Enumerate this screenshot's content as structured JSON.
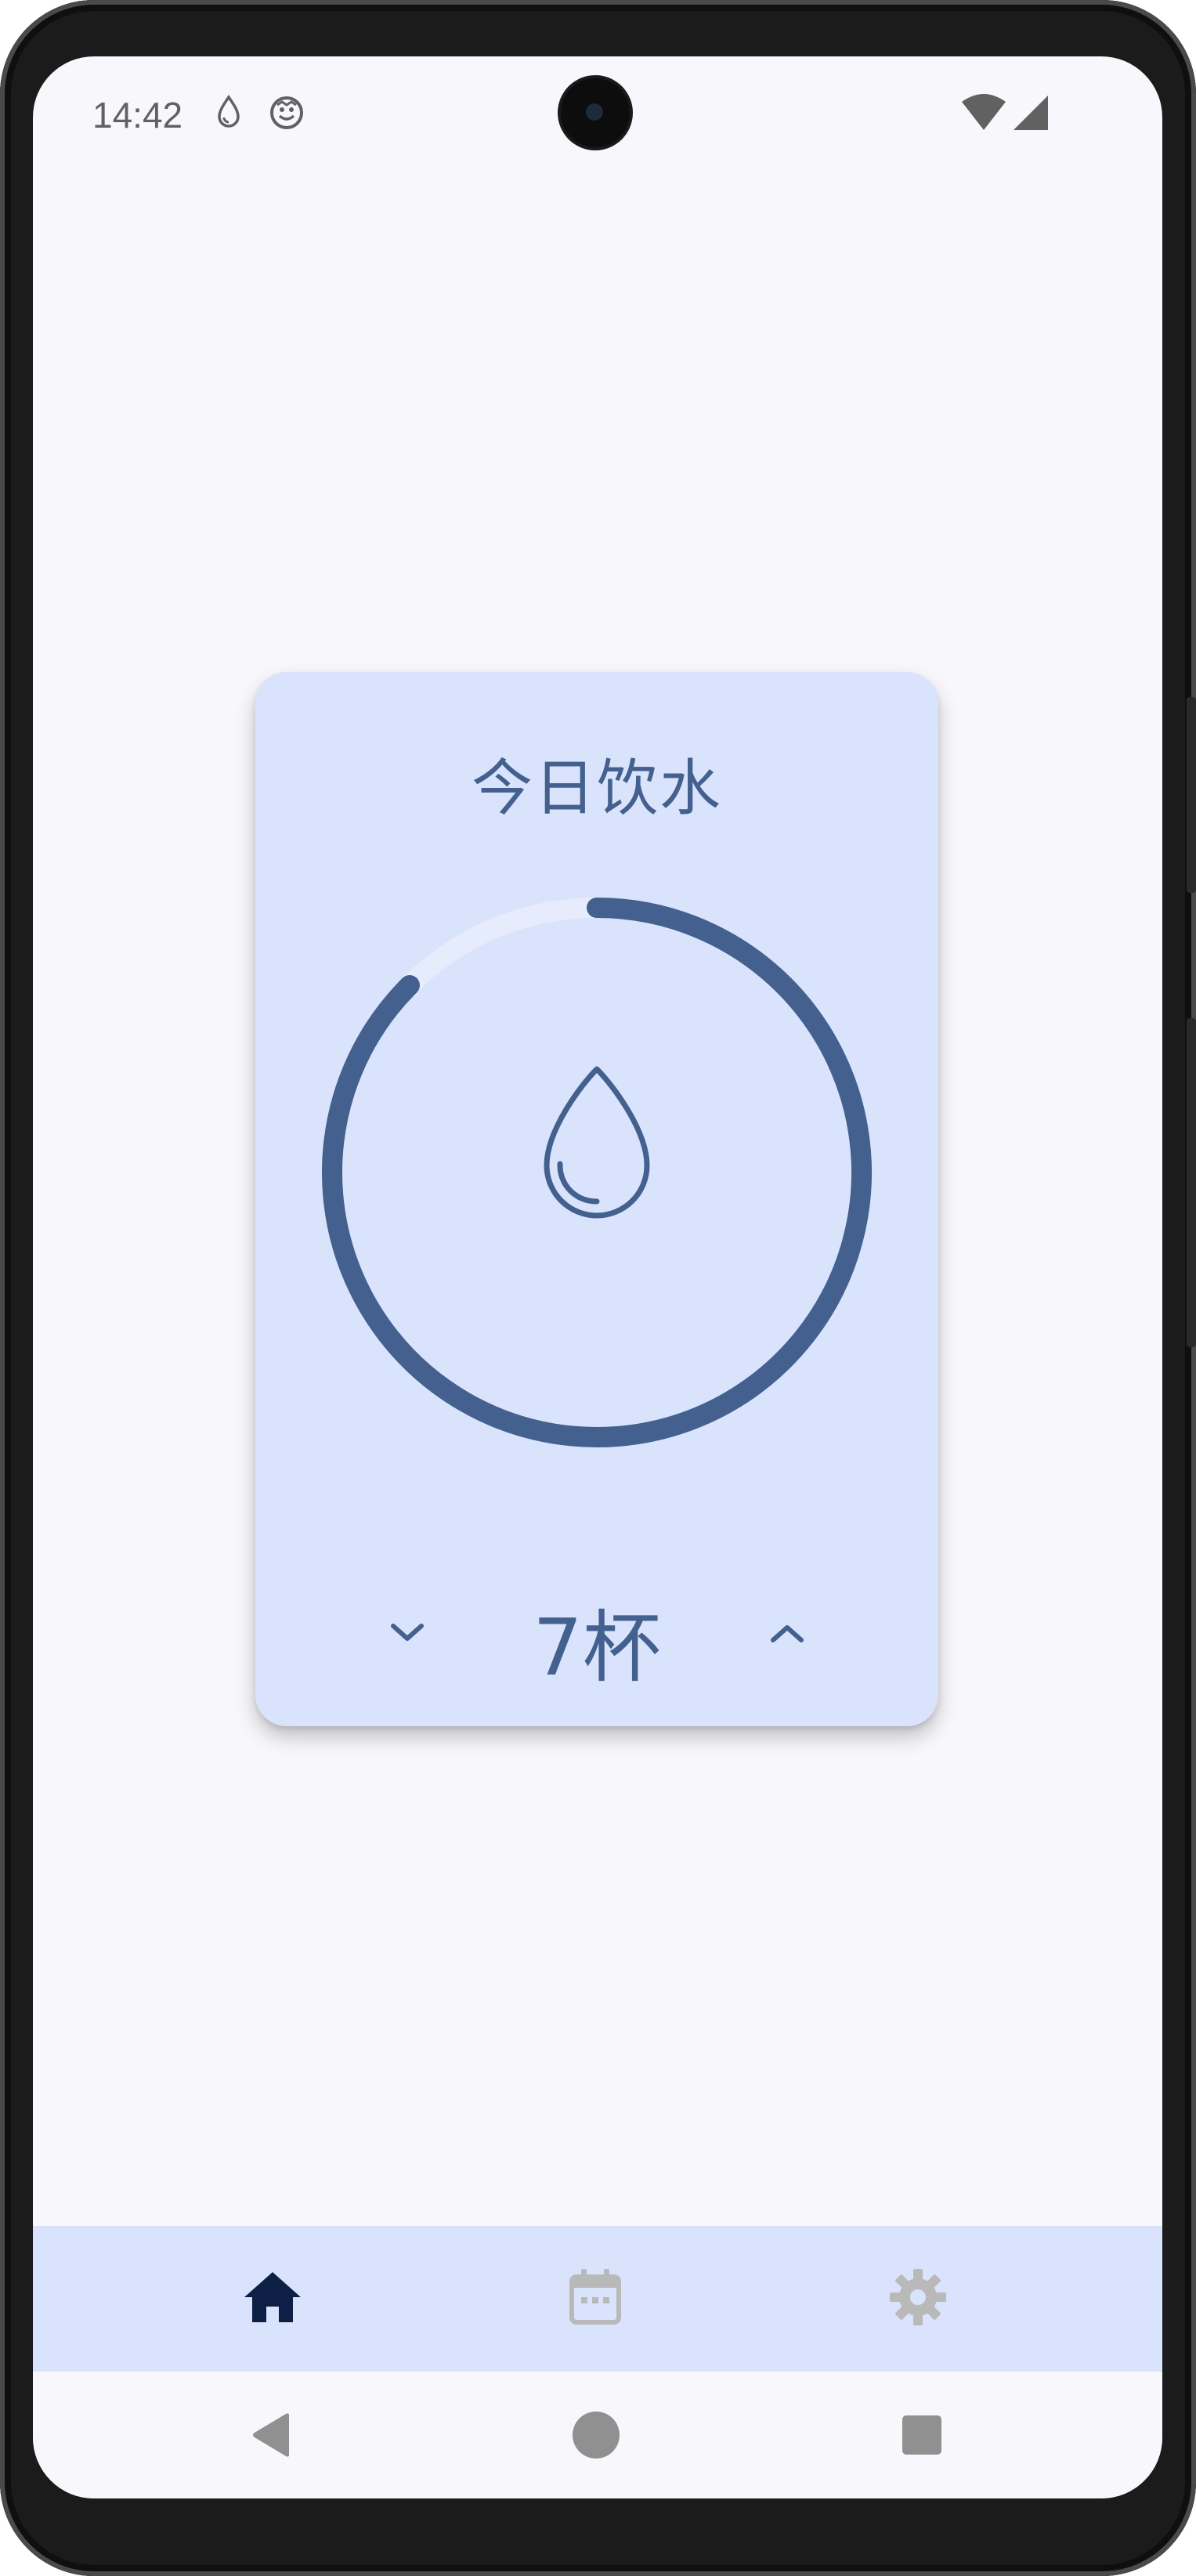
{
  "status_bar": {
    "time": "14:42",
    "notification_icons": [
      "water-drop-icon",
      "smiley-icon"
    ],
    "system_icons": [
      "wifi-icon",
      "cellular-signal-icon"
    ]
  },
  "card": {
    "title": "今日饮水",
    "progress_fraction": 0.875,
    "count_label": "7杯",
    "decrease_icon": "chevron-down-icon",
    "increase_icon": "chevron-up-icon",
    "center_icon": "water-drop-icon"
  },
  "bottom_nav": {
    "items": [
      {
        "icon": "home-icon",
        "selected": true
      },
      {
        "icon": "calendar-icon",
        "selected": false
      },
      {
        "icon": "settings-icon",
        "selected": false
      }
    ]
  },
  "system_nav": {
    "items": [
      "back-icon",
      "home-circle-icon",
      "recents-icon"
    ]
  },
  "colors": {
    "screen_bg": "#f8f8fc",
    "card_bg": "#d9e3fb",
    "accent": "#43608f",
    "nav_selected": "#0d1f45",
    "nav_unselected": "#b9b9b9",
    "ring_track": "#e6ecfb"
  }
}
